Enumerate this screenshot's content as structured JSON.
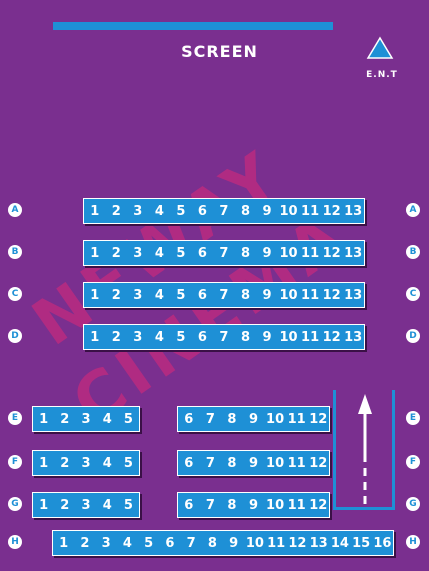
{
  "screen": {
    "label": "SCREEN"
  },
  "entrance": {
    "label": "E.N.T"
  },
  "watermark": {
    "text": "NEWAY CINEMA"
  },
  "colors": {
    "background": "#7a2f8f",
    "seat": "#1e90d6",
    "watermark": "#dc2878"
  },
  "rows": [
    {
      "label": "A",
      "blocks": [
        {
          "seats": [
            "1",
            "2",
            "3",
            "4",
            "5",
            "6",
            "7",
            "8",
            "9",
            "10",
            "11",
            "12",
            "13"
          ]
        }
      ]
    },
    {
      "label": "B",
      "blocks": [
        {
          "seats": [
            "1",
            "2",
            "3",
            "4",
            "5",
            "6",
            "7",
            "8",
            "9",
            "10",
            "11",
            "12",
            "13"
          ]
        }
      ]
    },
    {
      "label": "C",
      "blocks": [
        {
          "seats": [
            "1",
            "2",
            "3",
            "4",
            "5",
            "6",
            "7",
            "8",
            "9",
            "10",
            "11",
            "12",
            "13"
          ]
        }
      ]
    },
    {
      "label": "D",
      "blocks": [
        {
          "seats": [
            "1",
            "2",
            "3",
            "4",
            "5",
            "6",
            "7",
            "8",
            "9",
            "10",
            "11",
            "12",
            "13"
          ]
        }
      ]
    },
    {
      "label": "E",
      "blocks": [
        {
          "seats": [
            "1",
            "2",
            "3",
            "4",
            "5"
          ]
        },
        {
          "seats": [
            "6",
            "7",
            "8",
            "9",
            "10",
            "11",
            "12"
          ]
        }
      ]
    },
    {
      "label": "F",
      "blocks": [
        {
          "seats": [
            "1",
            "2",
            "3",
            "4",
            "5"
          ]
        },
        {
          "seats": [
            "6",
            "7",
            "8",
            "9",
            "10",
            "11",
            "12"
          ]
        }
      ]
    },
    {
      "label": "G",
      "blocks": [
        {
          "seats": [
            "1",
            "2",
            "3",
            "4",
            "5"
          ]
        },
        {
          "seats": [
            "6",
            "7",
            "8",
            "9",
            "10",
            "11",
            "12"
          ]
        }
      ]
    },
    {
      "label": "H",
      "blocks": [
        {
          "seats": [
            "1",
            "2",
            "3",
            "4",
            "5",
            "6",
            "7",
            "8",
            "9",
            "10",
            "11",
            "12",
            "13",
            "14",
            "15",
            "16"
          ]
        }
      ]
    }
  ]
}
